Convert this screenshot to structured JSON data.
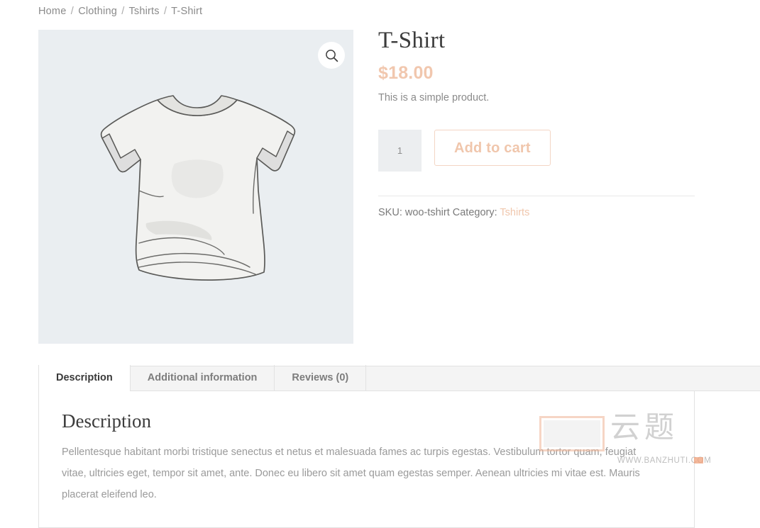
{
  "breadcrumb": {
    "separator": "/",
    "items": [
      {
        "label": "Home"
      },
      {
        "label": "Clothing"
      },
      {
        "label": "Tshirts"
      },
      {
        "label": "T-Shirt"
      }
    ]
  },
  "gallery": {
    "zoom_icon": "search-icon",
    "image_alt": "T-Shirt",
    "background_color": "#eaeef1"
  },
  "product": {
    "title": "T-Shirt",
    "price": "$18.00",
    "price_color": "#f1c7ae",
    "short_description": "This is a simple product.",
    "quantity_value": "1",
    "quantity_placeholder": "1",
    "add_to_cart_label": "Add to cart",
    "accent_color": "#f0c6ac"
  },
  "meta": {
    "sku_label": "SKU:",
    "sku_value": "woo-tshirt",
    "category_label": "Category:",
    "category_value": "Tshirts"
  },
  "tabs": {
    "items": [
      {
        "label": "Description",
        "active": true
      },
      {
        "label": "Additional information",
        "active": false
      },
      {
        "label": "Reviews (0)",
        "active": false
      }
    ]
  },
  "description_panel": {
    "heading": "Description",
    "body": "Pellentesque habitant morbi tristique senectus et netus et malesuada fames ac turpis egestas. Vestibulum tortor quam, feugiat vitae, ultricies eget, tempor sit amet, ante. Donec eu libero sit amet quam egestas semper. Aenean ultricies mi vitae est. Mauris placerat eleifend leo."
  },
  "watermark": {
    "cjk_text": "云题",
    "url_text": "WWW.BANZHUTI.COM"
  }
}
